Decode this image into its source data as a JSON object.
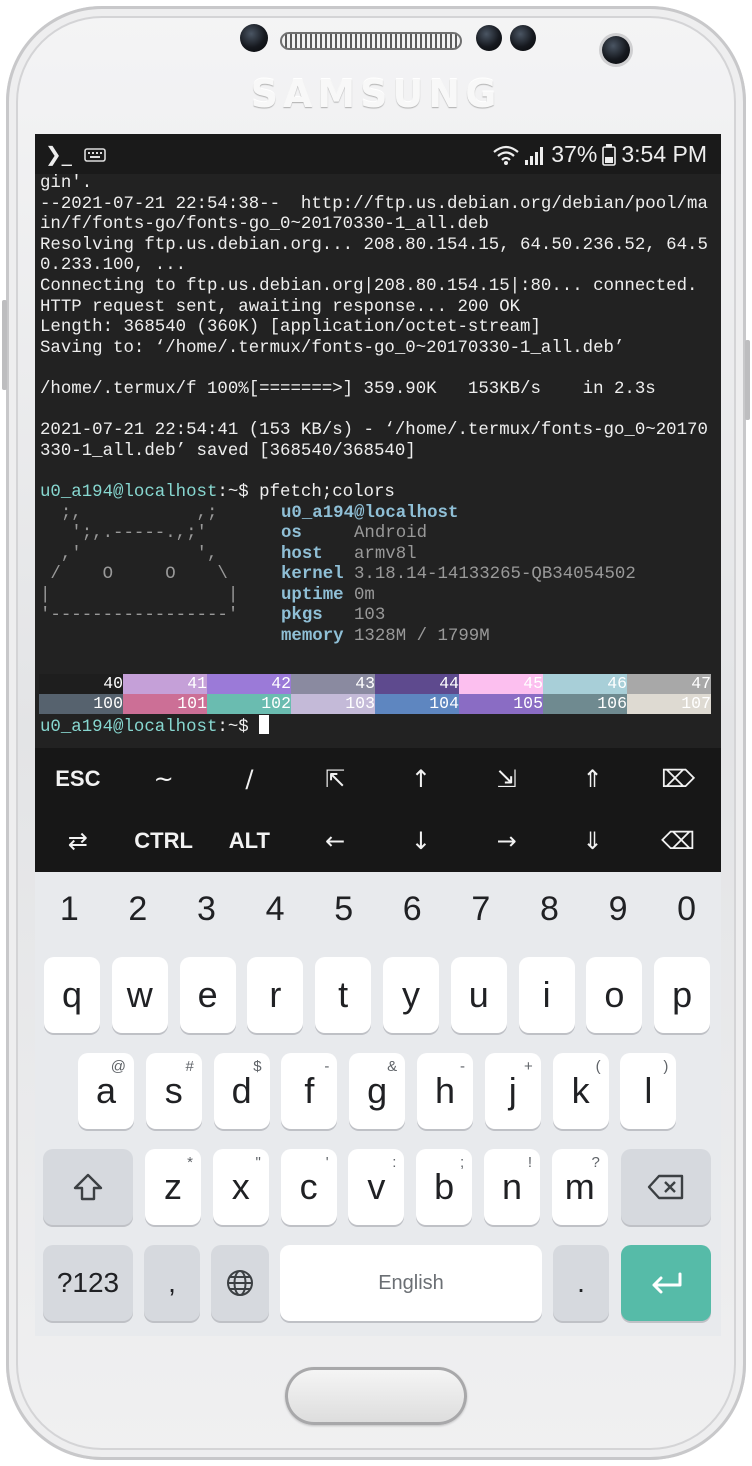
{
  "device": {
    "brand": "SAMSUNG"
  },
  "status_bar": {
    "left_icons": [
      "terminal-icon",
      "keyboard-icon"
    ],
    "battery": "37%",
    "time": "3:54 PM"
  },
  "terminal": {
    "lines": [
      "gin'.",
      "--2021-07-21 22:54:38--  http://ftp.us.debian.org/debian/pool/ma",
      "in/f/fonts-go/fonts-go_0~20170330-1_all.deb",
      "Resolving ftp.us.debian.org... 208.80.154.15, 64.50.236.52, 64.5",
      "0.233.100, ...",
      "Connecting to ftp.us.debian.org|208.80.154.15|:80... connected.",
      "HTTP request sent, awaiting response... 200 OK",
      "Length: 368540 (360K) [application/octet-stream]",
      "Saving to: ‘/home/.termux/fonts-go_0~20170330-1_all.deb’",
      "",
      "/home/.termux/f 100%[=======>] 359.90K   153KB/s    in 2.3s",
      "",
      "2021-07-21 22:54:41 (153 KB/s) - ‘/home/.termux/fonts-go_0~20170",
      "330-1_all.deb’ saved [368540/368540]",
      ""
    ],
    "prompt": "u0_a194@localhost",
    "prompt_suffix": ":~$ ",
    "command": "pfetch;colors",
    "ascii_art": [
      "  ;,           ,;",
      "   ';,.-----.,;'",
      "  ,'           ',",
      " /    O     O    \\",
      "|                 |",
      "'-----------------'"
    ],
    "pfetch": {
      "title": "u0_a194@localhost",
      "rows": [
        {
          "label": "os",
          "value": "Android"
        },
        {
          "label": "host",
          "value": "armv8l"
        },
        {
          "label": "kernel",
          "value": "3.18.14-14133265-QB34054502"
        },
        {
          "label": "uptime",
          "value": "0m"
        },
        {
          "label": "pkgs",
          "value": "103"
        },
        {
          "label": "memory",
          "value": "1328M / 1799M"
        }
      ]
    },
    "color_row_1": [
      {
        "label": "40",
        "color": "#1e1e1e"
      },
      {
        "label": "41",
        "color": "#c5a0d8"
      },
      {
        "label": "42",
        "color": "#9b7ad8"
      },
      {
        "label": "43",
        "color": "#8a8aa0"
      },
      {
        "label": "44",
        "color": "#5e4a8e"
      },
      {
        "label": "45",
        "color": "#fcbfef"
      },
      {
        "label": "46",
        "color": "#a8cfd8"
      },
      {
        "label": "47",
        "color": "#a8a8a8"
      }
    ],
    "color_row_2": [
      {
        "label": "100",
        "color": "#56626e"
      },
      {
        "label": "101",
        "color": "#cc6f96"
      },
      {
        "label": "102",
        "color": "#6abcb0"
      },
      {
        "label": "103",
        "color": "#c4bad8"
      },
      {
        "label": "104",
        "color": "#5e86c0"
      },
      {
        "label": "105",
        "color": "#8a6cc4"
      },
      {
        "label": "106",
        "color": "#6f8a90"
      },
      {
        "label": "107",
        "color": "#dedad2"
      }
    ],
    "final_prompt": "u0_a194@localhost",
    "final_suffix": ":~$ "
  },
  "extra_keys": {
    "row1": [
      {
        "label": "ESC",
        "name": "esc-key",
        "sym": false
      },
      {
        "label": "~",
        "name": "tilde-key",
        "sym": true
      },
      {
        "label": "/",
        "name": "slash-key",
        "sym": true
      },
      {
        "label": "⇱",
        "name": "home-key",
        "sym": true
      },
      {
        "label": "↑",
        "name": "up-arrow-key",
        "sym": true
      },
      {
        "label": "⇲",
        "name": "end-key",
        "sym": true
      },
      {
        "label": "⇑",
        "name": "page-up-key",
        "sym": true
      },
      {
        "label": "⌦",
        "name": "delete-key",
        "sym": true
      }
    ],
    "row2": [
      {
        "label": "⇄",
        "name": "tab-key",
        "sym": true
      },
      {
        "label": "CTRL",
        "name": "ctrl-key",
        "sym": false
      },
      {
        "label": "ALT",
        "name": "alt-key",
        "sym": false
      },
      {
        "label": "←",
        "name": "left-arrow-key",
        "sym": true
      },
      {
        "label": "↓",
        "name": "down-arrow-key",
        "sym": true
      },
      {
        "label": "→",
        "name": "right-arrow-key",
        "sym": true
      },
      {
        "label": "⇓",
        "name": "page-down-key",
        "sym": true
      },
      {
        "label": "⌫",
        "name": "backspace-extra-key",
        "sym": true
      }
    ]
  },
  "keyboard": {
    "numbers": [
      "1",
      "2",
      "3",
      "4",
      "5",
      "6",
      "7",
      "8",
      "9",
      "0"
    ],
    "row_q": [
      "q",
      "w",
      "e",
      "r",
      "t",
      "y",
      "u",
      "i",
      "o",
      "p"
    ],
    "row_a": [
      {
        "key": "a",
        "sup": "@"
      },
      {
        "key": "s",
        "sup": "#"
      },
      {
        "key": "d",
        "sup": "$"
      },
      {
        "key": "f",
        "sup": "-"
      },
      {
        "key": "g",
        "sup": "&"
      },
      {
        "key": "h",
        "sup": "-"
      },
      {
        "key": "j",
        "sup": "+"
      },
      {
        "key": "k",
        "sup": "("
      },
      {
        "key": "l",
        "sup": ")"
      }
    ],
    "row_z": [
      {
        "key": "z",
        "sup": "*"
      },
      {
        "key": "x",
        "sup": "\""
      },
      {
        "key": "c",
        "sup": "'"
      },
      {
        "key": "v",
        "sup": ":"
      },
      {
        "key": "b",
        "sup": ";"
      },
      {
        "key": "n",
        "sup": "!"
      },
      {
        "key": "m",
        "sup": "?"
      }
    ],
    "symbols_label": "?123",
    "comma": ",",
    "space_label": "English",
    "period": "."
  }
}
